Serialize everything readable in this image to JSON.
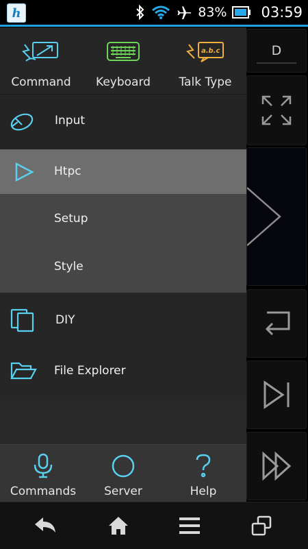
{
  "status_bar": {
    "battery": "83%",
    "time": "03:59"
  },
  "background_panel": {
    "top_tile_label": "D"
  },
  "drawer": {
    "top_tabs": [
      {
        "label": "Command",
        "icon": "command-icon"
      },
      {
        "label": "Keyboard",
        "icon": "keyboard-icon"
      },
      {
        "label": "Talk Type",
        "icon": "talk-type-icon"
      }
    ],
    "menu": {
      "input": "Input",
      "htpc": "Htpc",
      "setup": "Setup",
      "style": "Style",
      "diy": "DIY",
      "file_explorer": "File Explorer"
    },
    "bottom_tabs": [
      {
        "label": "Commands",
        "icon": "microphone-icon"
      },
      {
        "label": "Server",
        "icon": "circle-icon"
      },
      {
        "label": "Help",
        "icon": "question-icon"
      }
    ]
  },
  "colors": {
    "accent": "#1fa3e0",
    "icon_cyan": "#5ad0f0",
    "icon_green": "#6fd65a",
    "icon_orange": "#f0b040",
    "selected_item": "#6e6e6e"
  }
}
